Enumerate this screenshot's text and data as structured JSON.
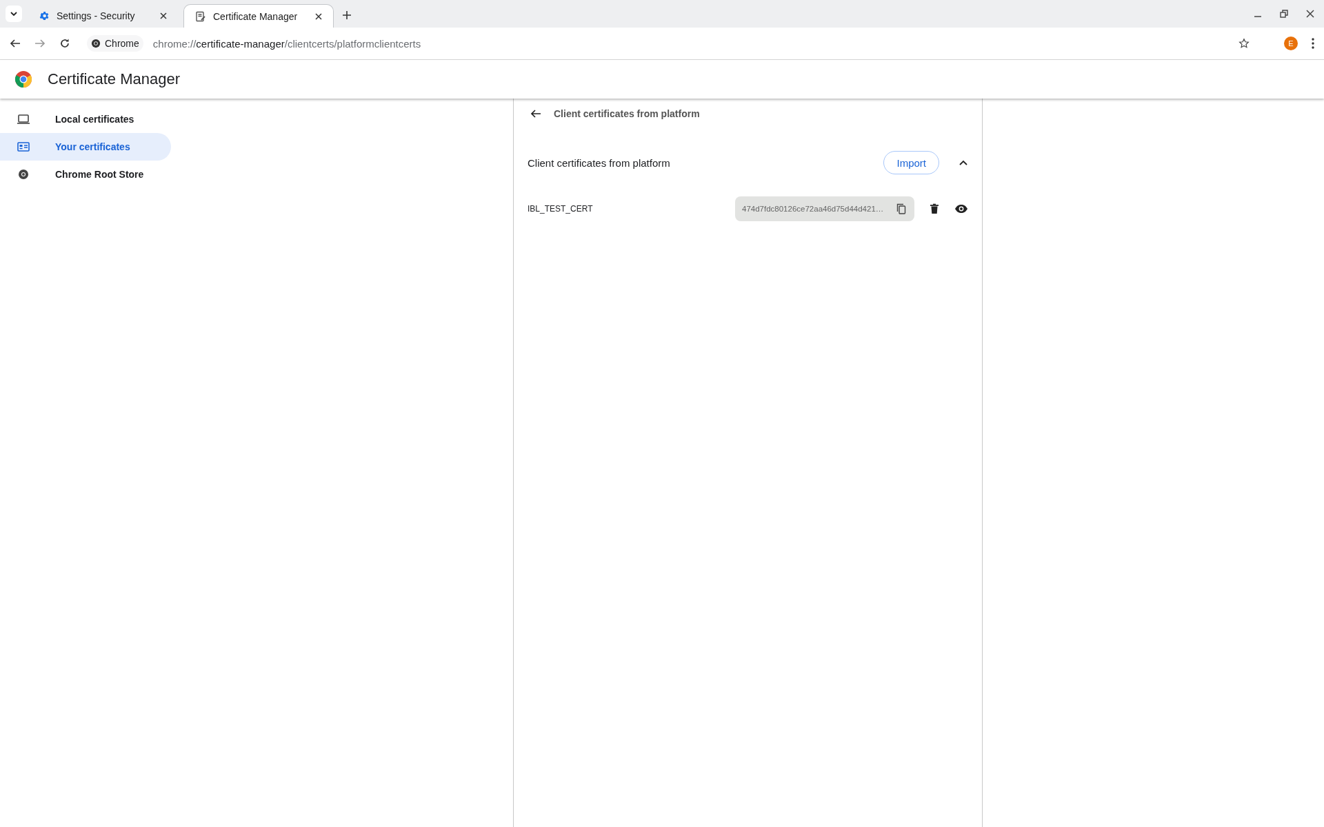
{
  "browser": {
    "tabs": [
      {
        "title": "Settings - Security",
        "kind": "settings",
        "selected": false
      },
      {
        "title": "Certificate Manager",
        "kind": "certificate",
        "selected": true
      }
    ],
    "address_bar": {
      "site_chip": "Chrome",
      "url_scheme": "chrome://",
      "url_host": "certificate-manager",
      "url_path": "/clientcerts/platformclientcerts"
    },
    "profile_initial": "E"
  },
  "page": {
    "title": "Certificate Manager",
    "sidebar": {
      "items": [
        {
          "label": "Local certificates",
          "kind": "laptop",
          "selected": false
        },
        {
          "label": "Your certificates",
          "kind": "card",
          "selected": true
        },
        {
          "label": "Chrome Root Store",
          "kind": "chrome",
          "selected": false
        }
      ]
    },
    "panel": {
      "back_title": "Client certificates from platform",
      "section": {
        "title": "Client certificates from platform",
        "import_button": "Import",
        "expanded": true,
        "certificates": [
          {
            "name": "IBL_TEST_CERT",
            "hash": "474d7fdc80126ce72aa46d75d44d421…"
          }
        ]
      }
    }
  }
}
